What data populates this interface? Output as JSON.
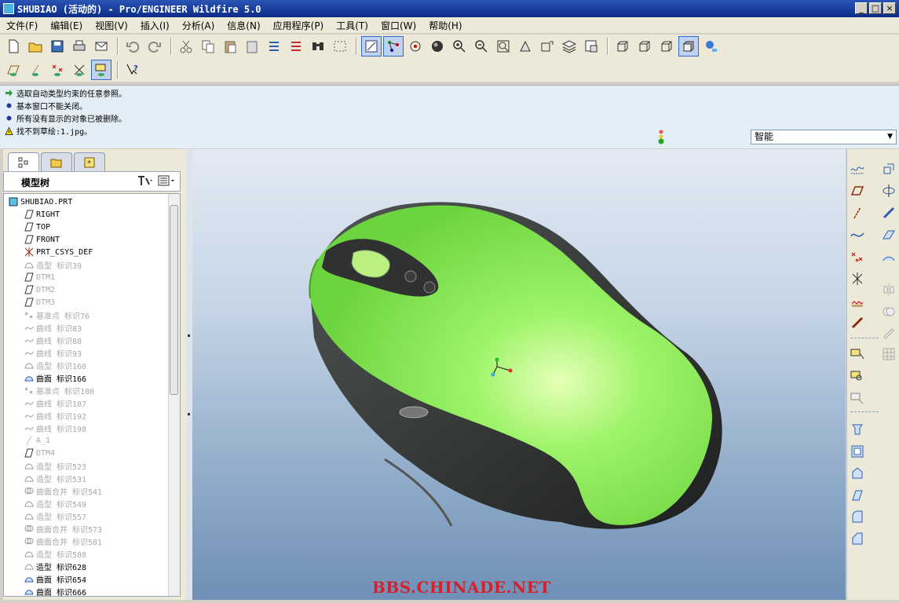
{
  "window": {
    "title": "SHUBIAO (活动的) - Pro/ENGINEER Wildfire 5.0"
  },
  "menu": [
    "文件(F)",
    "编辑(E)",
    "视图(V)",
    "插入(I)",
    "分析(A)",
    "信息(N)",
    "应用程序(P)",
    "工具(T)",
    "窗口(W)",
    "帮助(H)"
  ],
  "messages": [
    {
      "icon": "green-arrow-icon",
      "text": "选取自动类型约束的任意参照。"
    },
    {
      "icon": "blue-dot-icon",
      "text": "基本窗口不能关闭。"
    },
    {
      "icon": "blue-dot-icon",
      "text": "所有没有显示的对象已被删除。"
    },
    {
      "icon": "warning-icon",
      "text": "找不到草绘:1.jpg。"
    }
  ],
  "selector": {
    "value": "智能"
  },
  "model_tree": {
    "header": "模型树",
    "items": [
      {
        "label": "SHUBIAO.PRT",
        "dim": false,
        "icon": "part-icon"
      },
      {
        "label": "RIGHT",
        "dim": false,
        "icon": "plane-icon"
      },
      {
        "label": "TOP",
        "dim": false,
        "icon": "plane-icon"
      },
      {
        "label": "FRONT",
        "dim": false,
        "icon": "plane-icon"
      },
      {
        "label": "PRT_CSYS_DEF",
        "dim": false,
        "icon": "csys-icon"
      },
      {
        "label": "造型 标识39",
        "dim": true,
        "icon": "style-icon"
      },
      {
        "label": "DTM1",
        "dim": true,
        "icon": "plane-icon"
      },
      {
        "label": "DTM2",
        "dim": true,
        "icon": "plane-icon"
      },
      {
        "label": "DTM3",
        "dim": true,
        "icon": "plane-icon"
      },
      {
        "label": "基准点 标识76",
        "dim": true,
        "icon": "point-icon"
      },
      {
        "label": "曲线 标识83",
        "dim": true,
        "icon": "curve-icon"
      },
      {
        "label": "曲线 标识88",
        "dim": true,
        "icon": "curve-icon"
      },
      {
        "label": "曲线 标识93",
        "dim": true,
        "icon": "curve-icon"
      },
      {
        "label": "造型 标识160",
        "dim": true,
        "icon": "style-icon"
      },
      {
        "label": "曲面 标识166",
        "dim": false,
        "icon": "surface-icon"
      },
      {
        "label": "基准点 标识180",
        "dim": true,
        "icon": "point-icon"
      },
      {
        "label": "曲线 标识187",
        "dim": true,
        "icon": "curve-icon"
      },
      {
        "label": "曲线 标识192",
        "dim": true,
        "icon": "curve-icon"
      },
      {
        "label": "曲线 标识198",
        "dim": true,
        "icon": "curve-icon"
      },
      {
        "label": "A_1",
        "dim": true,
        "icon": "axis-icon"
      },
      {
        "label": "DTM4",
        "dim": true,
        "icon": "plane-icon"
      },
      {
        "label": "造型 标识523",
        "dim": true,
        "icon": "style-icon"
      },
      {
        "label": "造型 标识531",
        "dim": true,
        "icon": "style-icon"
      },
      {
        "label": "曲面合并 标识541",
        "dim": true,
        "icon": "merge-icon"
      },
      {
        "label": "造型 标识549",
        "dim": true,
        "icon": "style-icon"
      },
      {
        "label": "造型 标识557",
        "dim": true,
        "icon": "style-icon"
      },
      {
        "label": "曲面合并 标识573",
        "dim": true,
        "icon": "merge-icon"
      },
      {
        "label": "曲面合并 标识581",
        "dim": true,
        "icon": "merge-icon"
      },
      {
        "label": "造型 标识588",
        "dim": true,
        "icon": "style-icon"
      },
      {
        "label": "造型 标识628",
        "dim": false,
        "icon": "style-icon"
      },
      {
        "label": "曲面 标识654",
        "dim": false,
        "icon": "surface-icon"
      },
      {
        "label": "曲面 标识666",
        "dim": false,
        "icon": "surface-icon"
      }
    ]
  },
  "watermark": "BBS.CHINADE.NET",
  "colors": {
    "mouse_green": "#8ef05c",
    "mouse_black": "#2e302f",
    "title_blue": "#0a2c86"
  }
}
